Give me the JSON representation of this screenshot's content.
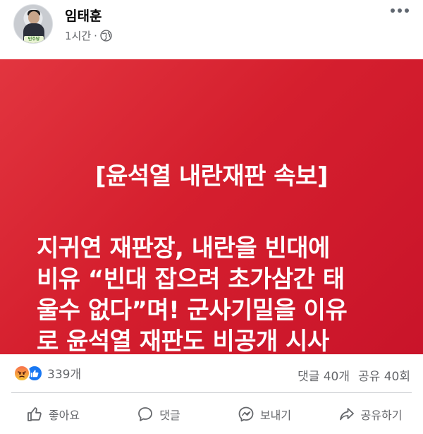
{
  "post": {
    "author": "임태훈",
    "time": "1시간",
    "dot": "·",
    "avatar_sign": "민주당"
  },
  "banner": {
    "title": "[윤석열 내란재판 속보]",
    "lines": [
      "지귀연 재판장, 내란을 빈대에",
      "비유 “빈대 잡으려 초가삼간 태",
      "울수 없다”며! 군사기밀을 이유",
      "로 윤석열 재판도 비공개 시사"
    ],
    "color": "#d51f2e"
  },
  "stats": {
    "reaction_count": "339개",
    "comments": "댓글 40개",
    "shares": "공유 40회"
  },
  "actions": [
    {
      "label": "좋아요",
      "icon": "like-icon"
    },
    {
      "label": "댓글",
      "icon": "comment-icon"
    },
    {
      "label": "보내기",
      "icon": "messenger-icon"
    },
    {
      "label": "공유하기",
      "icon": "share-icon"
    }
  ]
}
